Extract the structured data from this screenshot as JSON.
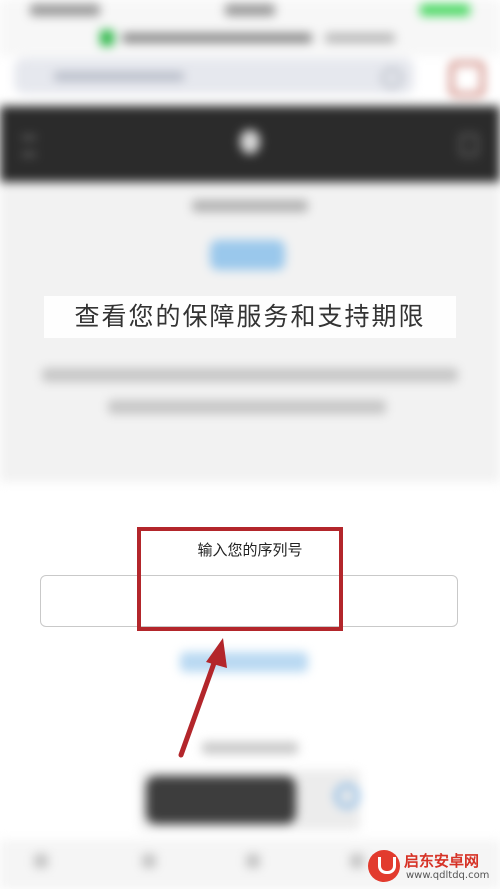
{
  "page": {
    "headline": "查看您的保障服务和支持期限",
    "serial_label": "输入您的序列号",
    "serial_value": ""
  },
  "watermark": {
    "brand": "启东安卓网",
    "url": "www.qdltdq.com"
  },
  "colors": {
    "annotation": "#b3262b",
    "navbar": "#2b2b2b",
    "hero_background": "#f2f2f2",
    "watermark_red": "#e23b2e"
  }
}
